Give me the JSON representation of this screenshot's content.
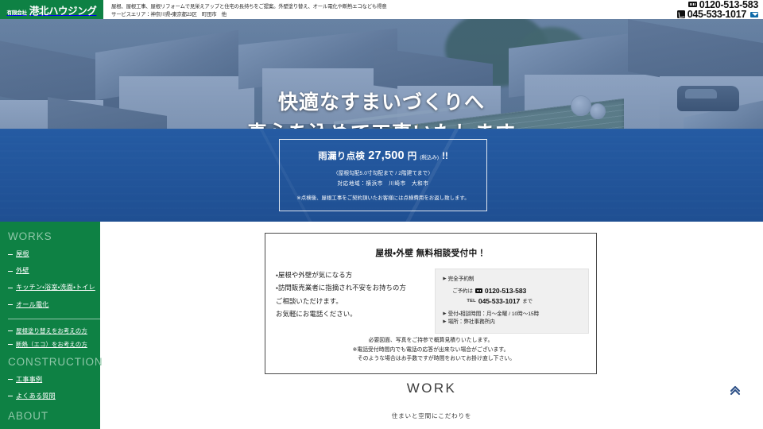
{
  "header": {
    "logo_prefix": "有限会社",
    "logo_name": "港北ハウジング",
    "tagline_1": "屋根、屋根工事、屋根リフォームで見栄えアップと住宅の長持ちをご提案。外壁塗り替え、オール電化や断熱エコなども得意",
    "tagline_2": "サービスエリア：神奈川県・東京都23区　町田市　他",
    "freedial": "0120-513-583",
    "tel": "045-533-1017",
    "freedial_icon": "freedial-icon",
    "phone_icon": "phone-icon",
    "mail_icon": "mail-icon"
  },
  "hero": {
    "line1": "快適なすまいづくりへ",
    "line2": "真心を込めて工事いたします",
    "overlay_color": "#224f96"
  },
  "promo": {
    "title": "雨漏り点検",
    "price": "27,500",
    "yen": "円",
    "tax_note": "(税込み)",
    "bang": "!!",
    "condition": "〈屋根勾配5.0寸勾配まで / 2階建てまで〉",
    "area": "対応地域：横浜市　川崎市　大和市",
    "note": "※点検後、屋根工事をご契約頂いたお客様には点検費用をお返し致します。"
  },
  "sidebar": {
    "bg_color": "#0e8144",
    "sections": [
      {
        "heading": "WORKS",
        "items": [
          "屋根",
          "外壁",
          "キッチン・浴室・洗面・トイレ",
          "オール電化"
        ]
      },
      {
        "heading": "",
        "items": [
          "屋根塗り替えをお考えの方",
          "断熱（エコ）をお考えの方"
        ]
      },
      {
        "heading": "CONSTRUCTION",
        "items": [
          "工事事例",
          "よくある質問"
        ]
      },
      {
        "heading": "ABOUT",
        "items": []
      }
    ]
  },
  "info_box": {
    "title": "屋根・外壁 無料相談受付中！",
    "left_lines": [
      "・屋根や外壁が気になる方",
      "・訪問販売業者に指摘され不安をお持ちの方",
      "ご相談いただけます。",
      "お気軽にお電話ください。"
    ],
    "gray_panel": {
      "row1": "完全予約制",
      "row2_label": "ご予約は",
      "row2_number": "0120-513-583",
      "row3_label": "TEL",
      "row3_number": "045-533-1017",
      "row3_suffix": "まで",
      "row4": "受付・相談時間：月～金曜 / 10時～15時",
      "row5": "場所：弊社事務所内"
    },
    "footer_lines": [
      "必要図面、写真をご持参で概算見積りいたします。",
      "※電話受付時間内でも電話の応答が出来ない場合がございます。",
      "そのような場合はお手数ですが時間をおいてお掛け直し下さい。"
    ]
  },
  "work_section": {
    "title": "WORK",
    "subtitle": "住まいと空間にこだわりを"
  },
  "page_top": {
    "icon": "chevron-double-up-icon",
    "color": "#2c4f86"
  }
}
